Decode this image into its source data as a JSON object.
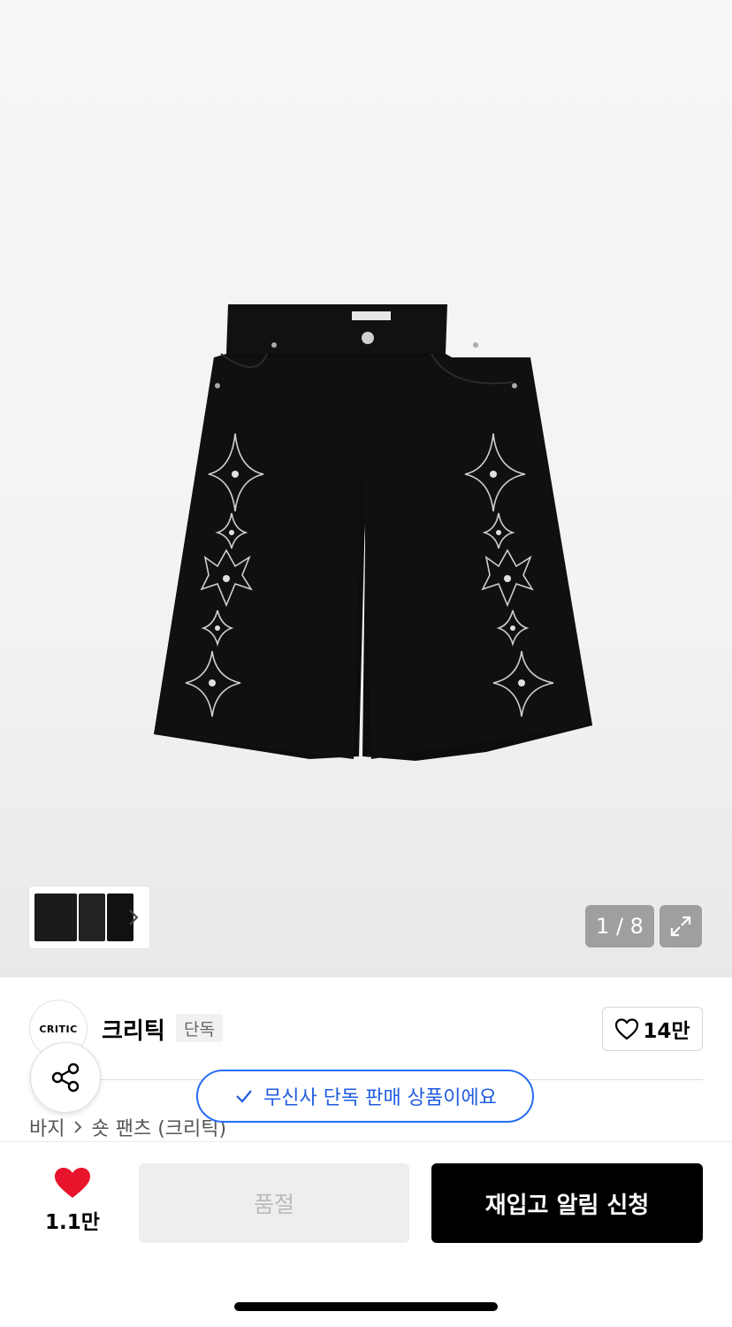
{
  "gallery": {
    "counter": "1 / 8",
    "expand_icon": "expand-icon",
    "thumbnail_chevron_icon": "chevron-right-icon"
  },
  "brand": {
    "logo_text": "CRITIC",
    "name": "크리틱",
    "badge": "단독"
  },
  "like_box": {
    "icon": "heart-outline-icon",
    "count": "14만"
  },
  "share": {
    "icon": "share-icon"
  },
  "toast": {
    "icon": "check-icon",
    "text": "무신사 단독 판매 상품이에요"
  },
  "breadcrumb": {
    "category": "바지",
    "separator_icon": "chevron-right-icon",
    "subcategory": "숏 팬츠 (크리틱)"
  },
  "bottom_bar": {
    "heart_icon": "heart-filled-icon",
    "heart_color": "#e8142b",
    "like_count": "1.1만",
    "soldout_label": "품절",
    "restock_label": "재입고 알림 신청"
  },
  "colors": {
    "accent_blue": "#2a6df4",
    "primary_button": "#000000",
    "disabled_button": "#eeeeee"
  }
}
